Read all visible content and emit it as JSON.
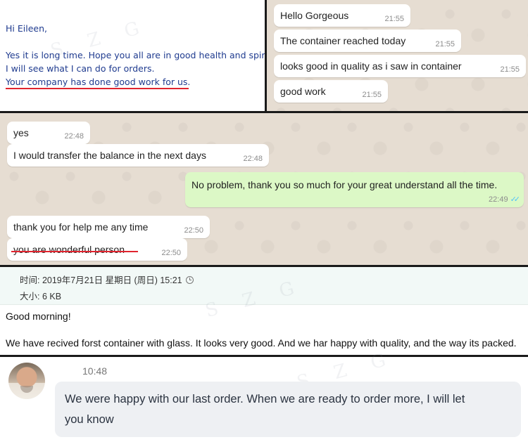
{
  "email_panel": {
    "greeting": "Hi Eileen,",
    "line1": "Yes it is long time. Hope you all are in good health and spirits.",
    "line2": "I will see what I can do for orders.",
    "line3": "Your company has done good work for us.",
    "watermark": "S Z G"
  },
  "chat_top_right": {
    "messages": [
      {
        "text": "Hello Gorgeous",
        "time": "21:55"
      },
      {
        "text": "The container reached today",
        "time": "21:55"
      },
      {
        "text": "looks good in quality as i saw in container",
        "time": "21:55"
      },
      {
        "text": "good work",
        "time": "21:55"
      }
    ]
  },
  "chat_middle": {
    "messages": [
      {
        "text": "yes",
        "time": "22:48",
        "direction": "in"
      },
      {
        "text": "I would transfer the balance in the next days",
        "time": "22:48",
        "direction": "in"
      },
      {
        "text": "No problem, thank you so much for your great understand all the time.",
        "time": "22:49",
        "direction": "out",
        "ticks": "✓✓"
      },
      {
        "text": "thank you for help me any time",
        "time": "22:50",
        "direction": "in"
      },
      {
        "text": "you are wonderful person",
        "time": "22:50",
        "direction": "in"
      }
    ]
  },
  "mail_info": {
    "time_line": "时间: 2019年7月21日 星期日 (周日) 15:21",
    "size_line": "大小: 6 KB",
    "body_greeting": "Good morning!",
    "body_text": "We have recived forst container with glass. It looks very good. And we har happy with quality, and the way its packed.",
    "watermark": "S Z G"
  },
  "chat_bottom": {
    "time": "10:48",
    "line1": "We were happy with our last order.  When we are ready to order more, I will let",
    "line2": "you know",
    "watermark": "S Z G"
  },
  "colors": {
    "underline": "#e0242f",
    "email_text": "#1f3b8f",
    "outgoing_bubble": "#dcf8c6",
    "wallpaper": "#e6ddd2"
  }
}
